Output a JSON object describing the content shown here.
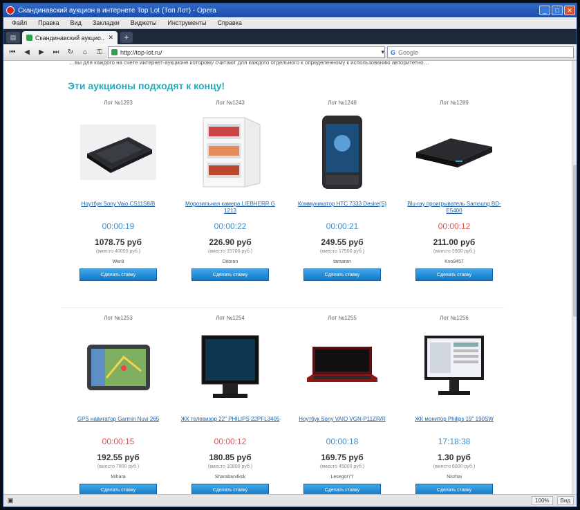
{
  "window": {
    "title": "Скандинавский аукцион в интернете  Top Lot (Топ Лот) - Opera"
  },
  "menu": [
    "Файл",
    "Правка",
    "Вид",
    "Закладки",
    "Виджеты",
    "Инструменты",
    "Справка"
  ],
  "tab": {
    "label": "Скандинавский аукцио..."
  },
  "address": {
    "url": "http://top-lot.ru/"
  },
  "search": {
    "placeholder": "Google",
    "engine": "G"
  },
  "page": {
    "cut_text": "…вы для каждого на счёте интернет-аукционе которому считают для каждого отдельного к определённому к использованию авторитетно…",
    "heading": "Эти аукционы подходят к концу!",
    "bid_label": "Сделать ставку",
    "lots": [
      {
        "lot": "Лот №1293",
        "name": "Ноутбук Sony Vaio CS11S8/B",
        "timer": "00:00:19",
        "timer_color": "blue",
        "price": "1078.75 руб",
        "sub": "(вместо 40000 руб.)",
        "user": "Wer8",
        "img": "laptop-closed"
      },
      {
        "lot": "Лот №1243",
        "name": "Морозильная камера LIEBHERR G 1213",
        "timer": "00:00:22",
        "timer_color": "blue",
        "price": "226.90 руб",
        "sub": "(вместо 15700 руб.)",
        "user": "Ditoron",
        "img": "freezer"
      },
      {
        "lot": "Лот №1248",
        "name": "Коммуникатор HTC 7333 Desire(S)",
        "timer": "00:00:21",
        "timer_color": "blue",
        "price": "249.55 руб",
        "sub": "(вместо 17500 руб.)",
        "user": "tamaran",
        "img": "phone"
      },
      {
        "lot": "Лот №1289",
        "name": "Blu-ray проигрыватель Samsung BD-E5400",
        "timer": "00:00:12",
        "timer_color": "red",
        "price": "211.00 руб",
        "sub": "(вместо 5900 руб.)",
        "user": "Kvo9457",
        "img": "bluray"
      },
      {
        "lot": "Лот №1253",
        "name": "GPS навигатор Garmin Nuvi 265",
        "timer": "00:00:15",
        "timer_color": "red",
        "price": "192.55 руб",
        "sub": "(вместо 7800 руб.)",
        "user": "Mihara",
        "img": "gps"
      },
      {
        "lot": "Лот №1254",
        "name": "ЖК телевизор 22\" PHILIPS 22PFL3405",
        "timer": "00:00:12",
        "timer_color": "red",
        "price": "180.85 руб",
        "sub": "(вместо 10800 руб.)",
        "user": "Sharaban4ksk",
        "img": "tv"
      },
      {
        "lot": "Лот №1255",
        "name": "Ноутбук Sony VAIO VGN-P11ZR/R",
        "timer": "00:00:18",
        "timer_color": "blue",
        "price": "169.75 руб",
        "sub": "(вместо 45000 руб.)",
        "user": "Lesegor77",
        "img": "netbook"
      },
      {
        "lot": "Лот №1256",
        "name": "ЖК монитор Philips 19\" 190SW",
        "timer": "17:18:38",
        "timer_color": "blue",
        "price": "1.30 руб",
        "sub": "(вместо 6000 руб.)",
        "user": "Nisrhai",
        "img": "monitor"
      }
    ]
  },
  "status": {
    "zoom": "100%",
    "view": "Вид"
  },
  "colors": {
    "heading": "#27a8b8",
    "link": "#1f5fa5",
    "timer_blue": "#3a8fd0",
    "timer_red": "#e0524a",
    "button": "#1479c6"
  }
}
